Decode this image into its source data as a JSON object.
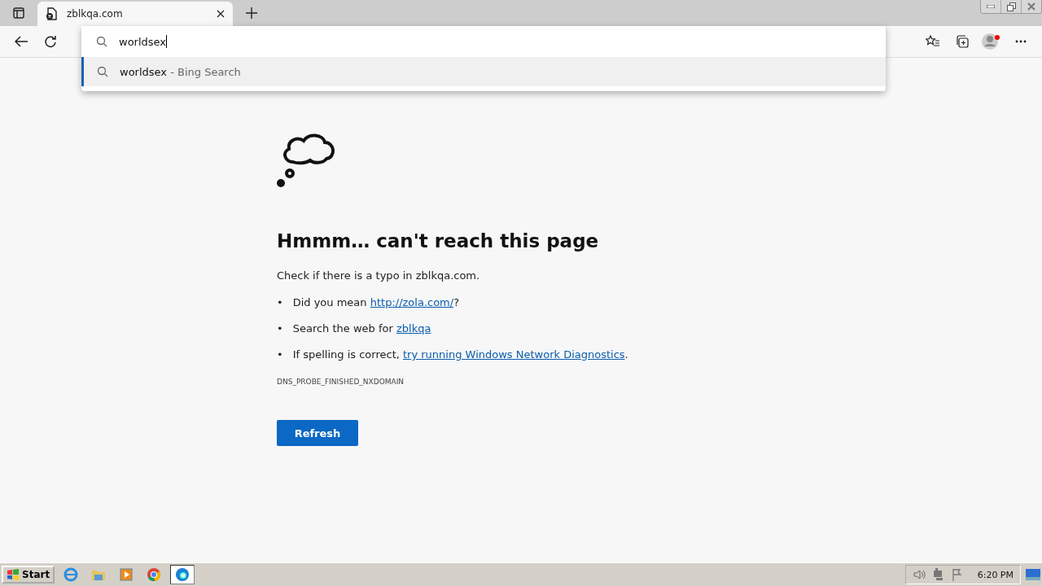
{
  "tab": {
    "title": "zblkqa.com"
  },
  "omnibox": {
    "value": "worldsex",
    "suggestions": [
      {
        "query": "worldsex",
        "suffix": " - Bing Search",
        "selected": true
      }
    ]
  },
  "error_page": {
    "heading": "Hmmm… can't reach this page",
    "intro": "Check if there is a typo in zblkqa.com.",
    "bullets": [
      {
        "marker": "•",
        "before": "Did you mean ",
        "link": "http://zola.com/",
        "after": "?"
      },
      {
        "marker": "•",
        "before": "Search the web for ",
        "link": "zblkqa"
      },
      {
        "marker": "•",
        "before": "If spelling is correct, ",
        "link": "try running Windows Network Diagnostics",
        "after": "."
      }
    ],
    "code": "DNS_PROBE_FINISHED_NXDOMAIN",
    "button": "Refresh"
  },
  "taskbar": {
    "start": "Start",
    "clock": "6:20 PM"
  }
}
